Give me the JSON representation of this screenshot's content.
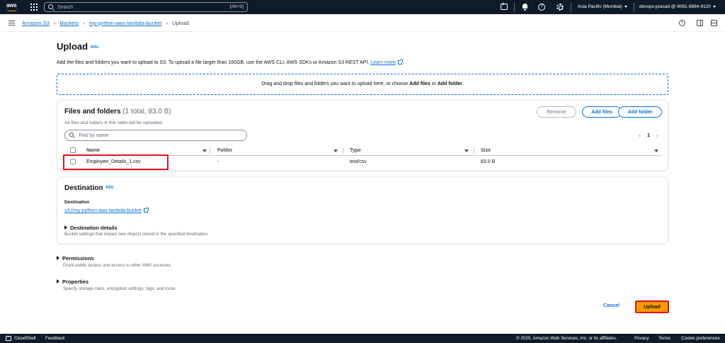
{
  "topnav": {
    "logo_text": "aws",
    "search_placeholder": "Search",
    "search_shortcut": "[Alt+S]",
    "region": "Asia Pacific (Mumbai)",
    "account": "devops-prasad @ 9081-9884-9120",
    "icons": [
      "cloudshell-icon",
      "bell-icon",
      "help-icon",
      "gear-icon"
    ]
  },
  "breadcrumb": {
    "items": [
      "Amazon S3",
      "Buckets",
      "my-python-aws-lambda-bucket"
    ],
    "current": "Upload"
  },
  "page": {
    "title": "Upload",
    "info": "Info",
    "description": "Add the files and folders you want to upload to S3. To upload a file larger than 160GB, use the AWS CLI, AWS SDKs or Amazon S3 REST API.",
    "learn_more": "Learn more"
  },
  "dropzone": {
    "text_pre": "Drag and drop files and folders you want to upload here, or choose ",
    "add_files": "Add files",
    "or": " or ",
    "add_folder": "Add folder",
    "end": "."
  },
  "files": {
    "title": "Files and folders",
    "count": "(1 total, 83.0 B)",
    "subtitle": "All files and folders in this table will be uploaded.",
    "remove_label": "Remove",
    "add_files_label": "Add files",
    "add_folder_label": "Add folder",
    "find_placeholder": "Find by name",
    "page_number": "1",
    "columns": [
      "Name",
      "Folder",
      "Type",
      "Size"
    ],
    "rows": [
      {
        "name": "Employee_Details_1.csv",
        "folder": "-",
        "type": "text/csv",
        "size": "83.0 B"
      }
    ]
  },
  "destination": {
    "title": "Destination",
    "info": "Info",
    "label": "Destination",
    "link": "s3://my-python-aws-lambda-bucket",
    "details_title": "Destination details",
    "details_sub": "Bucket settings that impact new objects stored in the specified destination."
  },
  "permissions": {
    "title": "Permissions",
    "sub": "Grant public access and access to other AWS accounts."
  },
  "properties": {
    "title": "Properties",
    "sub": "Specify storage class, encryption settings, tags, and more."
  },
  "actions": {
    "cancel": "Cancel",
    "upload": "Upload"
  },
  "footer": {
    "cloudshell": "CloudShell",
    "feedback": "Feedback",
    "copyright": "© 2025, Amazon Web Services, Inc. or its affiliates.",
    "privacy": "Privacy",
    "terms": "Terms",
    "cookies": "Cookie preferences"
  },
  "colors": {
    "nav_bg": "#0f1b2a",
    "link": "#0972d3",
    "primary": "#ff9900",
    "highlight": "#e3141b"
  }
}
